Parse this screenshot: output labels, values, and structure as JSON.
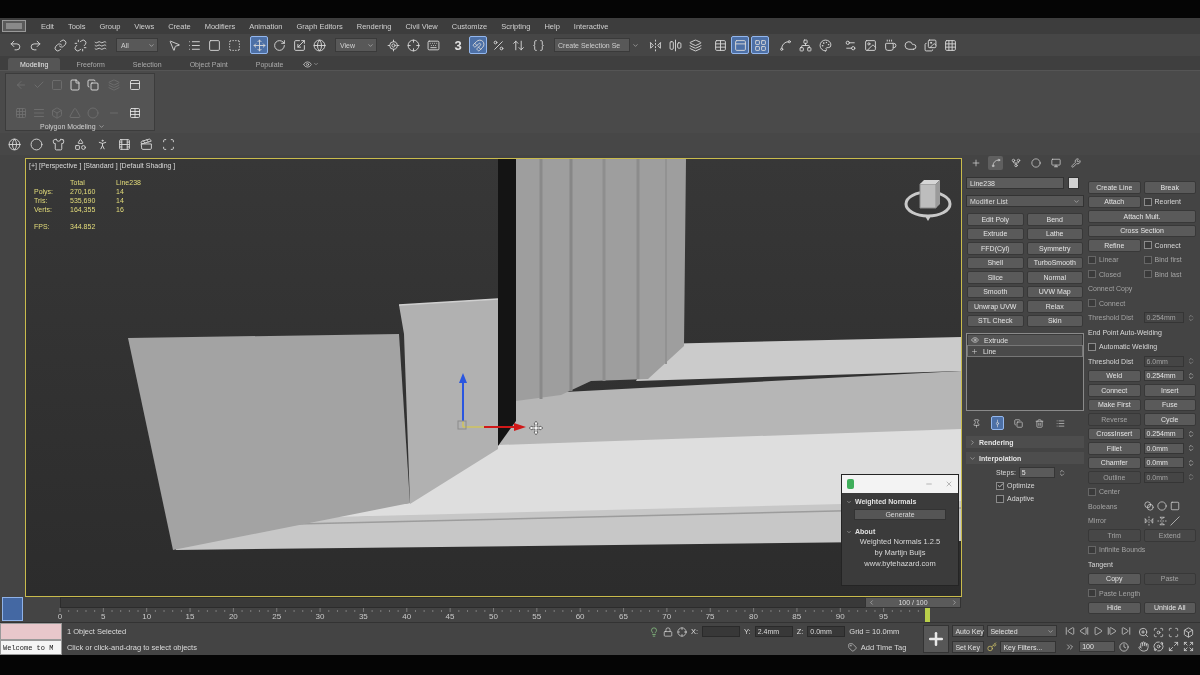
{
  "menu_bar": {
    "items": [
      "Edit",
      "Tools",
      "Group",
      "Views",
      "Create",
      "Modifiers",
      "Animation",
      "Graph Editors",
      "Rendering",
      "Civil View",
      "Customize",
      "Scripting",
      "Help",
      "Interactive"
    ]
  },
  "main_toolbar": {
    "items": [
      {
        "kind": "undo",
        "on": false
      },
      {
        "kind": "redo",
        "on": false
      },
      {
        "kind": "link",
        "on": false
      },
      {
        "kind": "unlink",
        "on": false
      },
      {
        "kind": "bind",
        "on": false
      },
      {
        "kind": "dropdown",
        "value": "All"
      },
      {
        "kind": "select",
        "on": false
      },
      {
        "kind": "select-by-name",
        "on": false
      },
      {
        "kind": "rect-region",
        "on": false
      },
      {
        "kind": "window-crossing",
        "on": false
      },
      {
        "kind": "move",
        "on": true
      },
      {
        "kind": "rotate",
        "on": false
      },
      {
        "kind": "scale",
        "on": false
      },
      {
        "kind": "place",
        "on": false
      },
      {
        "kind": "dropdown",
        "value": "View"
      },
      {
        "kind": "pivot",
        "on": false
      },
      {
        "kind": "manipulate",
        "on": false
      },
      {
        "kind": "keyboard",
        "on": false
      },
      {
        "kind": "snap",
        "label": "3",
        "on": false
      },
      {
        "kind": "angle-snap",
        "on": true
      },
      {
        "kind": "percent-snap",
        "on": false
      },
      {
        "kind": "spinner-snap",
        "on": false
      },
      {
        "kind": "named-sets",
        "on": false
      },
      {
        "kind": "combo",
        "placeholder": "Create Selection Se"
      },
      {
        "kind": "mirror",
        "on": false
      },
      {
        "kind": "align",
        "on": false
      },
      {
        "kind": "layers",
        "on": false
      },
      {
        "kind": "scene-explorer",
        "on": false
      },
      {
        "kind": "ribbon",
        "on": true
      },
      {
        "kind": "layer-explorer",
        "on": true
      },
      {
        "kind": "curve-editor",
        "on": false
      },
      {
        "kind": "schematic",
        "on": false
      },
      {
        "kind": "material-editor",
        "on": false
      },
      {
        "kind": "render-setup",
        "on": false
      },
      {
        "kind": "frame-window",
        "on": false
      },
      {
        "kind": "render",
        "on": false
      },
      {
        "kind": "render-cloud",
        "on": false
      },
      {
        "kind": "gallery",
        "on": false
      },
      {
        "kind": "viewport-layout",
        "on": false
      }
    ]
  },
  "ribbon": {
    "tabs": [
      {
        "label": "Modeling",
        "selected": true
      },
      {
        "label": "Freeform",
        "selected": false
      },
      {
        "label": "Selection",
        "selected": false
      },
      {
        "label": "Object Paint",
        "selected": false
      },
      {
        "label": "Populate",
        "selected": false
      }
    ],
    "panel": {
      "title": "Polygon Modeling",
      "tools": [
        {
          "kind": "arrow",
          "disabled": true
        },
        {
          "kind": "check",
          "disabled": true
        },
        {
          "kind": "frame",
          "disabled": true
        },
        {
          "kind": "page",
          "disabled": false
        },
        {
          "kind": "pages",
          "disabled": false
        },
        {
          "kind": "stack",
          "disabled": true
        },
        {
          "kind": "panel",
          "disabled": false
        },
        {
          "kind": "grid",
          "disabled": true
        },
        {
          "kind": "rows",
          "disabled": true
        },
        {
          "kind": "box",
          "disabled": true
        },
        {
          "kind": "triangle",
          "disabled": true
        },
        {
          "kind": "circle",
          "disabled": true
        },
        {
          "kind": "bar",
          "disabled": true
        },
        {
          "kind": "table",
          "disabled": false
        }
      ]
    }
  },
  "viewport": {
    "active": true,
    "labels": [
      "[+]",
      "[Perspective ]",
      "[Standard ]",
      "[Default Shading ]"
    ],
    "stats": {
      "columns": [
        "Total",
        "Line238"
      ],
      "rows": [
        {
          "label": "Polys:",
          "total": "270,160",
          "selection": "14"
        },
        {
          "label": "Tris:",
          "total": "535,690",
          "selection": "14"
        },
        {
          "label": "Verts:",
          "total": "164,355",
          "selection": "16"
        }
      ],
      "fps": {
        "label": "FPS:",
        "value": "344.852"
      }
    },
    "dialog": {
      "rollouts": [
        {
          "title": "Weighted Normals",
          "expanded": true,
          "button": "Generate"
        },
        {
          "title": "About",
          "expanded": true,
          "lines": [
            "Weighted Normals 1.2.5",
            "by Martijn Buijs",
            "www.bytehazard.com"
          ]
        }
      ]
    }
  },
  "command_panel": {
    "tabs": [
      {
        "kind": "create",
        "selected": false
      },
      {
        "kind": "modify",
        "selected": true
      },
      {
        "kind": "hierarchy",
        "selected": false
      },
      {
        "kind": "motion",
        "selected": false
      },
      {
        "kind": "display",
        "selected": false
      },
      {
        "kind": "utilities",
        "selected": false
      }
    ],
    "object_name": "Line238",
    "modifier_list": "Modifier List",
    "modifier_buttons": [
      "Edit Poly",
      "Bend",
      "Extrude",
      "Lathe",
      "FFD(Cyl)",
      "Symmetry",
      "Shell",
      "TurboSmooth",
      "Slice",
      "Normal",
      "Smooth",
      "UVW Map",
      "Unwrap UVW",
      "Relax",
      "STL Check",
      "Skin"
    ],
    "stack": [
      {
        "kind": "modifier",
        "label": "Extrude",
        "on": true,
        "selected": false
      },
      {
        "kind": "base",
        "label": "Line",
        "expanded": false,
        "selected": true
      }
    ],
    "stack_tools": [
      {
        "kind": "pin",
        "on": false
      },
      {
        "kind": "end-result",
        "on": true
      },
      {
        "kind": "unique",
        "on": false
      },
      {
        "kind": "remove",
        "on": false
      },
      {
        "kind": "configure",
        "on": false
      }
    ],
    "rollouts": [
      {
        "title": "Rendering",
        "expanded": false
      },
      {
        "title": "Interpolation",
        "expanded": true,
        "controls": [
          {
            "kind": "spinner",
            "label": "Steps:",
            "value": "5"
          },
          {
            "kind": "check",
            "label": "Optimize",
            "checked": true
          },
          {
            "kind": "check",
            "label": "Adaptive",
            "checked": false
          }
        ]
      }
    ],
    "geometry": {
      "rows": [
        {
          "cells": [
            {
              "kind": "button",
              "label": "Create Line",
              "disabled": false
            },
            {
              "kind": "button",
              "label": "Break",
              "disabled": false
            }
          ]
        },
        {
          "cells": [
            {
              "kind": "button",
              "label": "Attach",
              "disabled": false
            },
            {
              "kind": "check",
              "label": "Reorient",
              "checked": false,
              "disabled": false
            }
          ]
        },
        {
          "cells": [
            {
              "kind": "button",
              "label": "Attach Mult.",
              "disabled": false
            }
          ]
        },
        {
          "cells": [
            {
              "kind": "button",
              "label": "Cross Section",
              "disabled": false
            }
          ]
        },
        {
          "cells": [
            {
              "kind": "button",
              "label": "Refine",
              "disabled": false
            },
            {
              "kind": "check",
              "label": "Connect",
              "checked": false,
              "disabled": false
            }
          ]
        },
        {
          "cells": [
            {
              "kind": "check",
              "label": "Linear",
              "checked": false,
              "disabled": true
            },
            {
              "kind": "check",
              "label": "Bind first",
              "checked": false,
              "disabled": true
            }
          ]
        },
        {
          "cells": [
            {
              "kind": "check",
              "label": "Closed",
              "checked": false,
              "disabled": true
            },
            {
              "kind": "check",
              "label": "Bind last",
              "checked": false,
              "disabled": true
            }
          ]
        },
        {
          "cells": [
            {
              "kind": "text",
              "label": "Connect Copy",
              "disabled": true
            }
          ]
        },
        {
          "cells": [
            {
              "kind": "check",
              "label": "Connect",
              "checked": false,
              "disabled": true
            }
          ]
        },
        {
          "cells": [
            {
              "kind": "text",
              "label": "Threshold Dist",
              "disabled": true
            },
            {
              "kind": "field",
              "value": "0.254mm",
              "disabled": true
            }
          ]
        },
        {
          "cells": [
            {
              "kind": "text",
              "label": "End Point Auto-Welding",
              "disabled": false
            }
          ]
        },
        {
          "cells": [
            {
              "kind": "check",
              "label": "Automatic Welding",
              "checked": false,
              "disabled": false
            }
          ]
        },
        {
          "cells": [
            {
              "kind": "text",
              "label": "Threshold Dist",
              "disabled": false
            },
            {
              "kind": "field",
              "value": "6.0mm",
              "disabled": true
            }
          ]
        },
        {
          "cells": [
            {
              "kind": "button",
              "label": "Weld",
              "disabled": false
            },
            {
              "kind": "field",
              "value": "0.254mm",
              "disabled": false
            }
          ]
        },
        {
          "cells": [
            {
              "kind": "button",
              "label": "Connect",
              "disabled": false
            },
            {
              "kind": "button",
              "label": "Insert",
              "disabled": false
            }
          ]
        },
        {
          "cells": [
            {
              "kind": "button",
              "label": "Make First",
              "disabled": false
            },
            {
              "kind": "button",
              "label": "Fuse",
              "disabled": false
            }
          ]
        },
        {
          "cells": [
            {
              "kind": "button",
              "label": "Reverse",
              "disabled": true
            },
            {
              "kind": "button",
              "label": "Cycle",
              "disabled": false
            }
          ]
        },
        {
          "cells": [
            {
              "kind": "button",
              "label": "CrossInsert",
              "disabled": false
            },
            {
              "kind": "field",
              "value": "0.254mm",
              "disabled": false
            }
          ]
        },
        {
          "cells": [
            {
              "kind": "button",
              "label": "Fillet",
              "disabled": false
            },
            {
              "kind": "field",
              "value": "0.0mm",
              "disabled": false
            }
          ]
        },
        {
          "cells": [
            {
              "kind": "button",
              "label": "Chamfer",
              "disabled": false
            },
            {
              "kind": "field",
              "value": "0.0mm",
              "disabled": false
            }
          ]
        },
        {
          "cells": [
            {
              "kind": "button",
              "label": "Outline",
              "disabled": true
            },
            {
              "kind": "field",
              "value": "0.0mm",
              "disabled": true
            }
          ]
        },
        {
          "cells": [
            {
              "kind": "check",
              "label": "Center",
              "checked": false,
              "disabled": true
            }
          ]
        },
        {
          "cells": [
            {
              "kind": "text",
              "label": "Booleans",
              "disabled": true
            },
            {
              "kind": "booleans",
              "disabled": false
            }
          ]
        },
        {
          "cells": [
            {
              "kind": "text",
              "label": "Mirror",
              "disabled": true
            },
            {
              "kind": "mirror",
              "disabled": false
            }
          ]
        },
        {
          "cells": [
            {
              "kind": "button",
              "label": "Trim",
              "disabled": true
            },
            {
              "kind": "button",
              "label": "Extend",
              "disabled": true
            }
          ]
        },
        {
          "cells": [
            {
              "kind": "check",
              "label": "Infinite Bounds",
              "checked": false,
              "disabled": true
            }
          ]
        },
        {
          "cells": [
            {
              "kind": "text",
              "label": "Tangent",
              "disabled": false
            }
          ]
        },
        {
          "cells": [
            {
              "kind": "button",
              "label": "Copy",
              "disabled": false
            },
            {
              "kind": "button",
              "label": "Paste",
              "disabled": true
            }
          ]
        },
        {
          "cells": [
            {
              "kind": "check",
              "label": "Paste Length",
              "checked": false,
              "disabled": true
            }
          ]
        },
        {
          "cells": [
            {
              "kind": "button",
              "label": "Hide",
              "disabled": false
            },
            {
              "kind": "button",
              "label": "Unhide All",
              "disabled": false
            }
          ]
        }
      ]
    }
  },
  "time_slider": {
    "label": "100 / 100",
    "level": 1
  },
  "track_bar": {
    "frames": [
      "0",
      "5",
      "10",
      "15",
      "20",
      "25",
      "30",
      "35",
      "40",
      "45",
      "50",
      "55",
      "60",
      "65",
      "70",
      "75",
      "80",
      "85",
      "90",
      "95"
    ]
  },
  "status_bar": {
    "script_output": "Welcome to M",
    "selection": "1 Object Selected",
    "prompt": "Click or click-and-drag to select objects",
    "coordinates": [
      {
        "axis": "X:"
      },
      {
        "axis": "Y:",
        "value": "2.4mm"
      },
      {
        "axis": "Z:",
        "value": "0.0mm"
      }
    ],
    "grid": "Grid = 10.0mm",
    "time_tag": "Add Time Tag",
    "auto_key": "Auto Key",
    "key_set": "Selected",
    "set_key": "Set Key",
    "key_filters": "Key Filters...",
    "frame": "100"
  }
}
